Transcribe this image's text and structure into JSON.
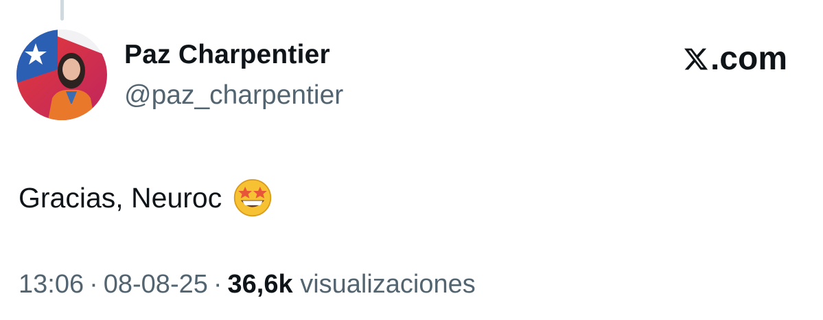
{
  "author": {
    "display_name": "Paz Charpentier",
    "handle": "@paz_charpentier",
    "avatar_icon": "profile-photo-chile-flag"
  },
  "brand": {
    "logo_icon": "x-logo-icon",
    "suffix": ".com"
  },
  "tweet": {
    "text": "Gracias, Neuroc",
    "emoji": "star-struck-emoji"
  },
  "meta": {
    "time": "13:06",
    "date": "08-08-25",
    "views_count": "36,6k",
    "views_label": "visualizaciones",
    "separator": "·"
  },
  "colors": {
    "text": "#0f1419",
    "secondary": "#536471",
    "thread_line": "#cfd9de"
  }
}
